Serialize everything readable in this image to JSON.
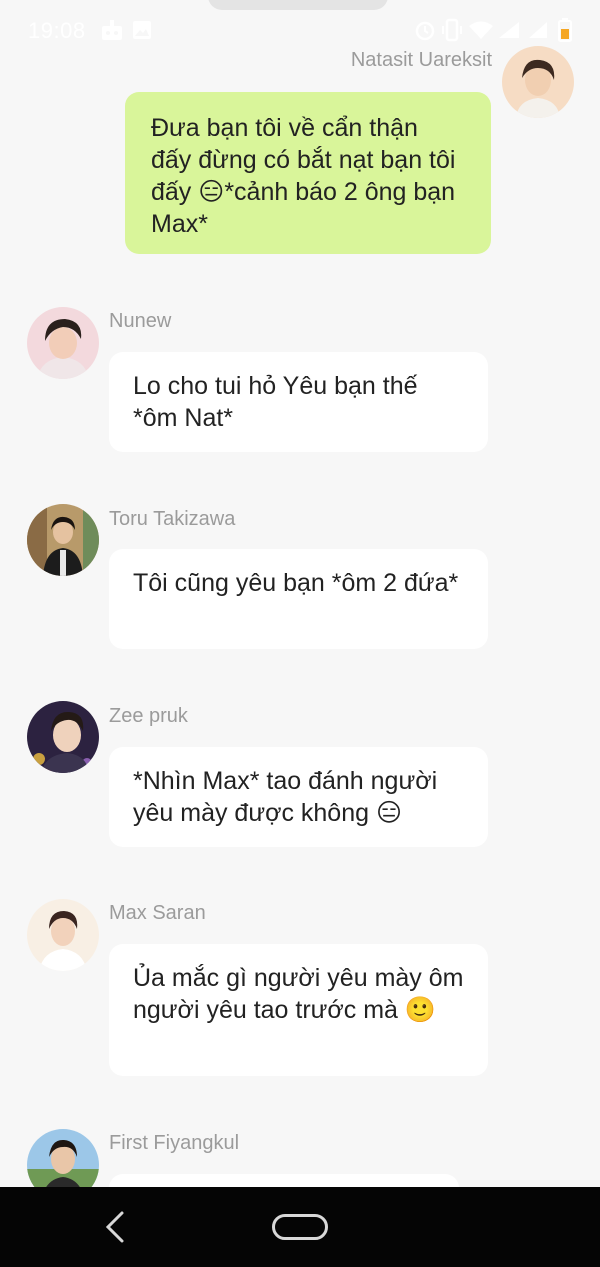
{
  "status_bar": {
    "time": "19:08",
    "icons": [
      "game-notification-icon",
      "image-notification-icon",
      "alarm-icon",
      "vibrate-icon",
      "wifi-icon",
      "signal-icon",
      "battery-low-icon"
    ]
  },
  "messages": [
    {
      "sender": "Natasit  Uareksit",
      "direction": "outgoing",
      "text": "Đưa bạn tôi về cẩn thận đấy đừng có bắt nạt bạn tôi đấy 😑*cảnh báo 2 ông bạn Max*"
    },
    {
      "sender": "Nunew",
      "direction": "incoming",
      "text": "Lo cho tui hỏ Yêu bạn thế *ôm Nat*"
    },
    {
      "sender": "Toru Takizawa",
      "direction": "incoming",
      "text": "Tôi cũng yêu bạn *ôm 2 đứa*"
    },
    {
      "sender": "Zee pruk",
      "direction": "incoming",
      "text": "*Nhìn Max* tao đánh người yêu mày được không 😑"
    },
    {
      "sender": "Max Saran",
      "direction": "incoming",
      "text": "Ủa mắc gì người yêu mày ôm người yêu tao trước mà 🙂"
    },
    {
      "sender": "First Fiyangkul",
      "direction": "incoming",
      "text": ""
    }
  ],
  "nav_bar": {
    "icons": [
      "back-icon",
      "home-icon"
    ]
  },
  "colors": {
    "background": "#f7f7f7",
    "outgoing_bubble": "#d9f59a",
    "incoming_bubble": "#ffffff",
    "sender_name": "#9b9b9b",
    "nav_bar": "#050505"
  }
}
